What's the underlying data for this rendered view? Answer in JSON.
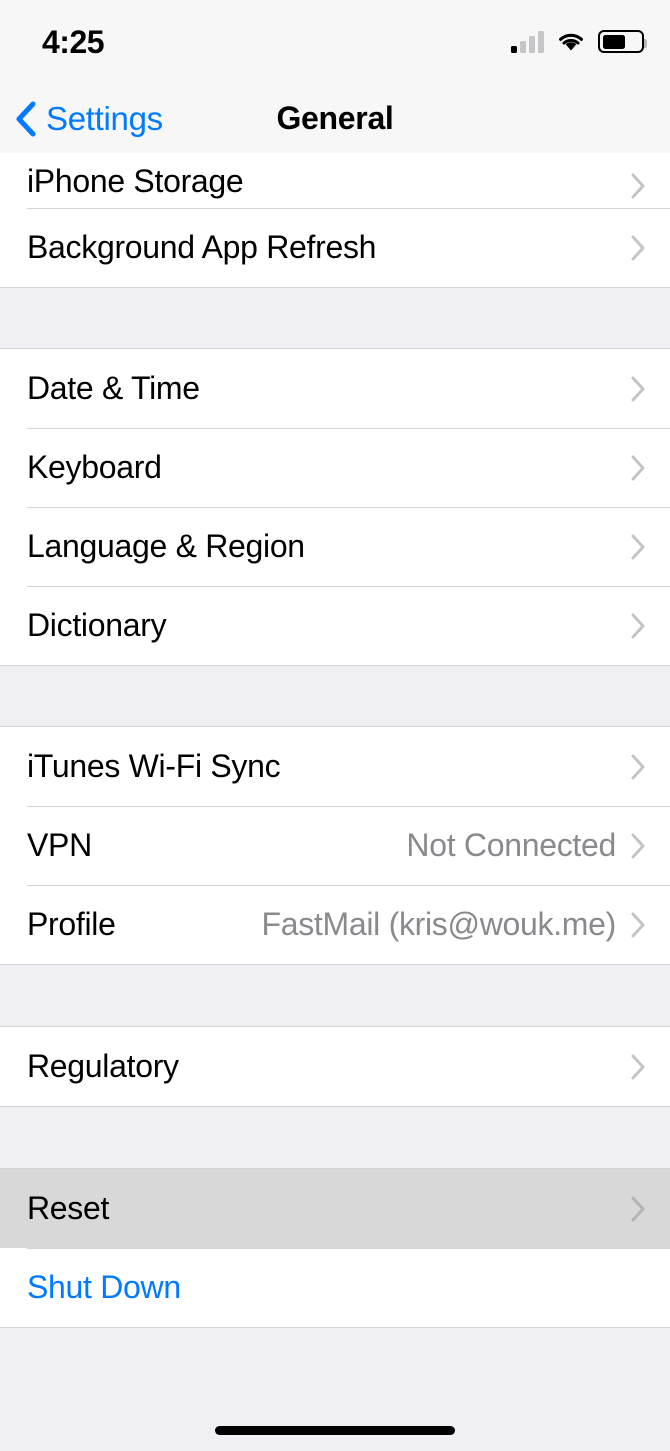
{
  "status_bar": {
    "time": "4:25",
    "cellular_icon": "cellular-signal-icon",
    "cellular_bars_total": 4,
    "cellular_bars_active": 1,
    "wifi_icon": "wifi-icon",
    "battery_icon": "battery-icon",
    "battery_level_percent": 55
  },
  "nav_bar": {
    "back_icon": "chevron-left-icon",
    "back_label": "Settings",
    "title": "General"
  },
  "sections": [
    {
      "id": "storage-section",
      "partial_top": true,
      "rows": [
        {
          "label": "iPhone Storage",
          "value": "",
          "accessory": "chevron-right-icon",
          "style": "default",
          "partial": true
        },
        {
          "label": "Background App Refresh",
          "value": "",
          "accessory": "chevron-right-icon",
          "style": "default",
          "partial": false
        }
      ]
    },
    {
      "id": "locale-section",
      "partial_top": false,
      "rows": [
        {
          "label": "Date & Time",
          "value": "",
          "accessory": "chevron-right-icon",
          "style": "default",
          "partial": false
        },
        {
          "label": "Keyboard",
          "value": "",
          "accessory": "chevron-right-icon",
          "style": "default",
          "partial": false
        },
        {
          "label": "Language & Region",
          "value": "",
          "accessory": "chevron-right-icon",
          "style": "default",
          "partial": false
        },
        {
          "label": "Dictionary",
          "value": "",
          "accessory": "chevron-right-icon",
          "style": "default",
          "partial": false
        }
      ]
    },
    {
      "id": "network-section",
      "partial_top": false,
      "rows": [
        {
          "label": "iTunes Wi-Fi Sync",
          "value": "",
          "accessory": "chevron-right-icon",
          "style": "default",
          "partial": false
        },
        {
          "label": "VPN",
          "value": "Not Connected",
          "accessory": "chevron-right-icon",
          "style": "default",
          "partial": false
        },
        {
          "label": "Profile",
          "value": "FastMail (kris@wouk.me)",
          "accessory": "chevron-right-icon",
          "style": "default",
          "partial": false
        }
      ]
    },
    {
      "id": "regulatory-section",
      "partial_top": false,
      "rows": [
        {
          "label": "Regulatory",
          "value": "",
          "accessory": "chevron-right-icon",
          "style": "default",
          "partial": false
        }
      ]
    },
    {
      "id": "reset-section",
      "partial_top": false,
      "rows": [
        {
          "label": "Reset",
          "value": "",
          "accessory": "chevron-right-icon",
          "style": "highlighted",
          "partial": false
        },
        {
          "label": "Shut Down",
          "value": "",
          "accessory": "none",
          "style": "link",
          "partial": false
        }
      ]
    }
  ],
  "home_indicator": "home-indicator-bar",
  "colors": {
    "accent_blue": "#007AFF",
    "group_background": "#FFFFFF",
    "page_background": "#EFEFF4",
    "separator": "#D4D4D6",
    "value_text": "#8A8A8E",
    "chevron": "#C4C4C6",
    "highlight": "#D8D8D8",
    "bar_background": "#F7F7F8"
  }
}
